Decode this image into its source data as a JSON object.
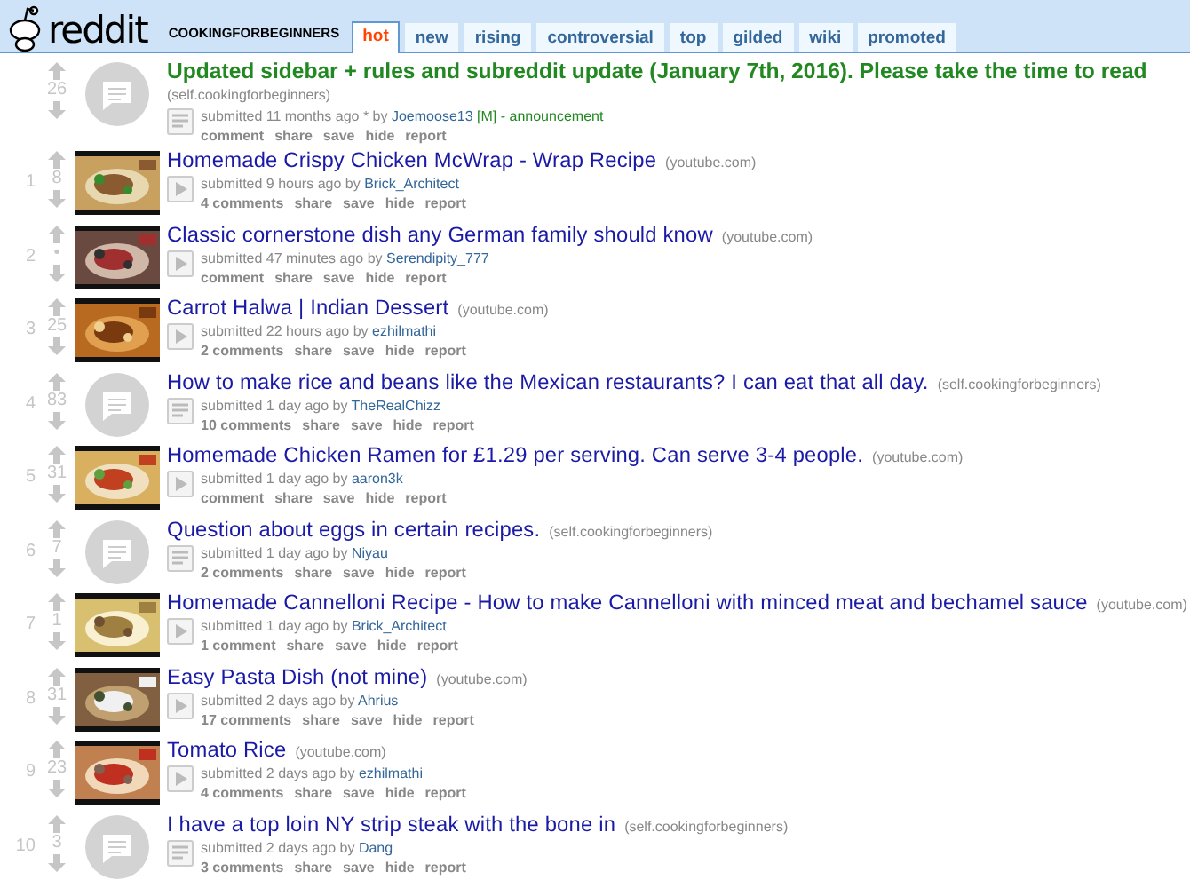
{
  "header": {
    "logo_text": "reddit",
    "subreddit": "COOKINGFORBEGINNERS",
    "tabs": [
      {
        "label": "hot",
        "selected": true
      },
      {
        "label": "new",
        "selected": false
      },
      {
        "label": "rising",
        "selected": false
      },
      {
        "label": "controversial",
        "selected": false
      },
      {
        "label": "top",
        "selected": false
      },
      {
        "label": "gilded",
        "selected": false
      },
      {
        "label": "wiki",
        "selected": false
      },
      {
        "label": "promoted",
        "selected": false
      }
    ]
  },
  "posts": [
    {
      "kind": "announcement",
      "score": "26",
      "thumbnail": {
        "kind": "self"
      },
      "expando": {
        "kind": "text"
      },
      "title": "Updated sidebar + rules and subreddit update (January 7th, 2016). Please take the time to read",
      "domain": "(self.cookingforbeginners)",
      "submitted": "submitted 11 months ago * by",
      "author": "Joemoose13",
      "author_tag": "[M]",
      "distinction": "- announcement",
      "actions": [
        "comment",
        "share",
        "save",
        "hide",
        "report"
      ]
    },
    {
      "kind": "link",
      "rank": "1",
      "score": "8",
      "expando": {
        "kind": "video"
      },
      "title": "Homemade Crispy Chicken McWrap - Wrap Recipe",
      "domain": "(youtube.com)",
      "submitted": "submitted 9 hours ago by",
      "author": "Brick_Architect",
      "actions": [
        "4 comments",
        "share",
        "save",
        "hide",
        "report"
      ]
    },
    {
      "kind": "link",
      "rank": "2",
      "score": "•",
      "expando": {
        "kind": "video"
      },
      "title": "Classic cornerstone dish any German family should know",
      "domain": "(youtube.com)",
      "submitted": "submitted 47 minutes ago by",
      "author": "Serendipity_777",
      "actions": [
        "comment",
        "share",
        "save",
        "hide",
        "report"
      ]
    },
    {
      "kind": "link",
      "rank": "3",
      "score": "25",
      "expando": {
        "kind": "video"
      },
      "title": "Carrot Halwa | Indian Dessert",
      "domain": "(youtube.com)",
      "submitted": "submitted 22 hours ago by",
      "author": "ezhilmathi",
      "actions": [
        "2 comments",
        "share",
        "save",
        "hide",
        "report"
      ]
    },
    {
      "kind": "link",
      "rank": "4",
      "score": "83",
      "thumbnail": {
        "kind": "self"
      },
      "expando": {
        "kind": "text"
      },
      "title": "How to make rice and beans like the Mexican restaurants? I can eat that all day.",
      "domain": "(self.cookingforbeginners)",
      "submitted": "submitted 1 day ago by",
      "author": "TheRealChizz",
      "actions": [
        "10 comments",
        "share",
        "save",
        "hide",
        "report"
      ]
    },
    {
      "kind": "link",
      "rank": "5",
      "score": "31",
      "expando": {
        "kind": "video"
      },
      "title": "Homemade Chicken Ramen for £1.29 per serving. Can serve 3-4 people.",
      "domain": "(youtube.com)",
      "submitted": "submitted 1 day ago by",
      "author": "aaron3k",
      "actions": [
        "comment",
        "share",
        "save",
        "hide",
        "report"
      ]
    },
    {
      "kind": "link",
      "rank": "6",
      "score": "7",
      "thumbnail": {
        "kind": "self"
      },
      "expando": {
        "kind": "text"
      },
      "title": "Question about eggs in certain recipes.",
      "domain": "(self.cookingforbeginners)",
      "submitted": "submitted 1 day ago by",
      "author": "Niyau",
      "actions": [
        "2 comments",
        "share",
        "save",
        "hide",
        "report"
      ]
    },
    {
      "kind": "link",
      "rank": "7",
      "score": "1",
      "expando": {
        "kind": "video"
      },
      "title": "Homemade Cannelloni Recipe - How to make Cannelloni with minced meat and bechamel sauce",
      "domain": "(youtube.com)",
      "submitted": "submitted 1 day ago by",
      "author": "Brick_Architect",
      "actions": [
        "1 comment",
        "share",
        "save",
        "hide",
        "report"
      ]
    },
    {
      "kind": "link",
      "rank": "8",
      "score": "31",
      "expando": {
        "kind": "video"
      },
      "title": "Easy Pasta Dish (not mine)",
      "domain": "(youtube.com)",
      "submitted": "submitted 2 days ago by",
      "author": "Ahrius",
      "actions": [
        "17 comments",
        "share",
        "save",
        "hide",
        "report"
      ]
    },
    {
      "kind": "link",
      "rank": "9",
      "score": "23",
      "expando": {
        "kind": "video"
      },
      "title": "Tomato Rice",
      "domain": "(youtube.com)",
      "submitted": "submitted 2 days ago by",
      "author": "ezhilmathi",
      "actions": [
        "4 comments",
        "share",
        "save",
        "hide",
        "report"
      ]
    },
    {
      "kind": "link",
      "rank": "10",
      "score": "3",
      "thumbnail": {
        "kind": "self"
      },
      "expando": {
        "kind": "text"
      },
      "title": "I have a top loin NY strip steak with the bone in",
      "domain": "(self.cookingforbeginners)",
      "submitted": "submitted 2 days ago by",
      "author": "Dang",
      "actions": [
        "3 comments",
        "share",
        "save",
        "hide",
        "report"
      ]
    }
  ]
}
